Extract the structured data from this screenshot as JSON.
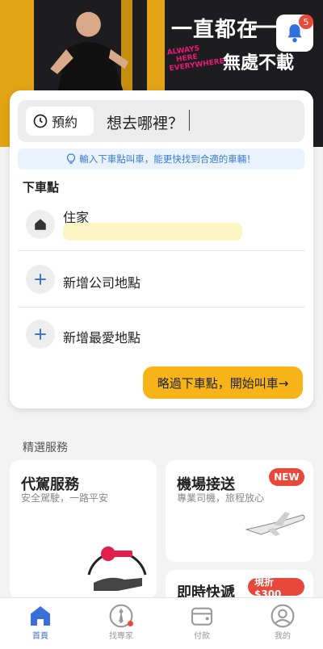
{
  "hero": {
    "headline": "一直都在",
    "headline2": "無處不載",
    "tagline_lines": [
      "ALWAYS",
      "HERE",
      "EVERYWHERE"
    ],
    "notification_count": "5"
  },
  "booking": {
    "reserve_label": "預約",
    "search_placeholder": "想去哪裡？",
    "tip_text": "輸入下車點叫車，能更快找到合適的車輛！",
    "section_title": "下車點",
    "home_label": "住家",
    "add_company_label": "新增公司地點",
    "add_favorite_label": "新增最愛地點",
    "skip_button_label": "略過下車點，開始叫車→"
  },
  "services": {
    "section_title": "精選服務",
    "designated_driver": {
      "title": "代駕服務",
      "subtitle": "安全駕駛，一路平安"
    },
    "airport": {
      "title": "機場接送",
      "subtitle": "專業司機，旅程放心",
      "badge": "NEW"
    },
    "express": {
      "title": "即時快遞",
      "badge": "現折 $300"
    }
  },
  "nav": {
    "items": [
      {
        "label": "首頁",
        "icon": "home-icon",
        "active": true
      },
      {
        "label": "找專家",
        "icon": "tie-icon",
        "active": false
      },
      {
        "label": "付款",
        "icon": "wallet-icon",
        "active": false
      },
      {
        "label": "我的",
        "icon": "profile-icon",
        "active": false
      }
    ]
  },
  "colors": {
    "brand_yellow": "#f6b419",
    "accent_blue": "#3a6fd8",
    "badge_red": "#e8473c",
    "tip_blue": "#3b7bd4"
  }
}
